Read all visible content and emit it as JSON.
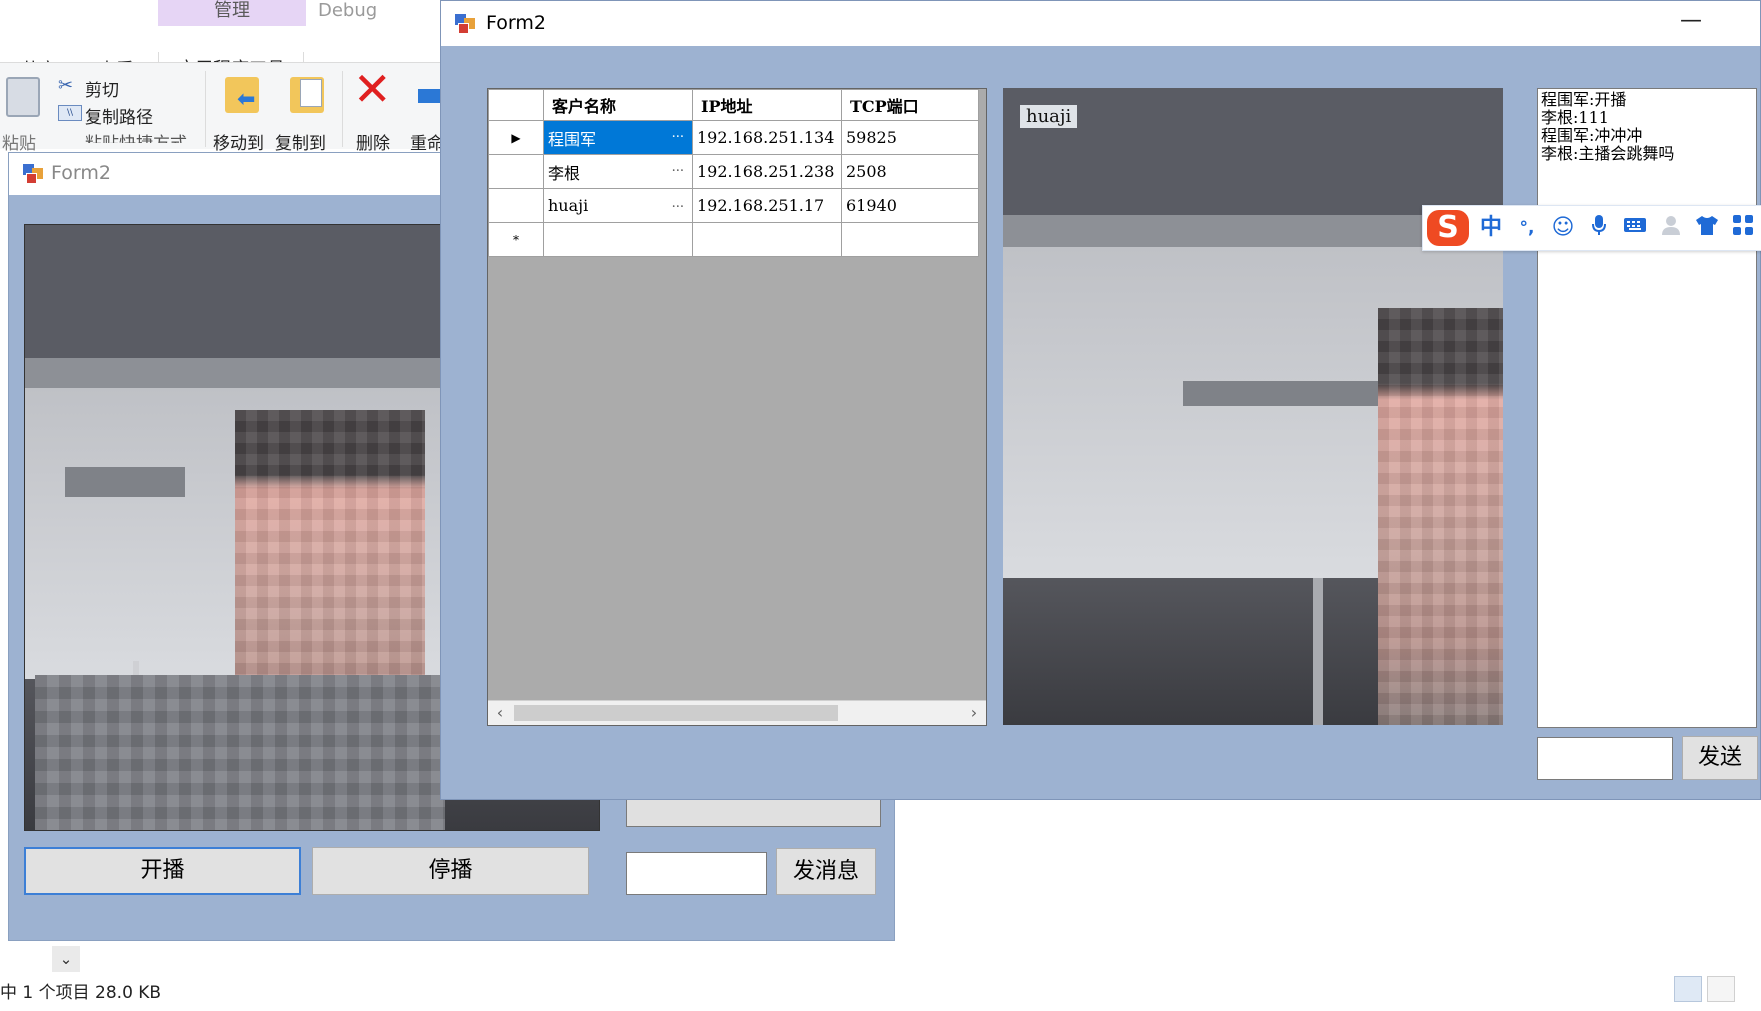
{
  "explorer": {
    "ribbon": {
      "context_header": "管理",
      "debug_label": "Debug",
      "tabs": [
        "共享",
        "查看",
        "应用程序工具"
      ],
      "buttons": {
        "paste": "粘贴",
        "cut": "剪切",
        "copy_path": "复制路径",
        "paste_shortcut": "粘贴快捷方式",
        "move_to": "移动到",
        "copy_to": "复制到",
        "delete": "删除",
        "rename": "重命"
      }
    },
    "status": {
      "selection": "中 1 个项目  28.0 KB"
    }
  },
  "form_back": {
    "title": "Form2",
    "start_button": "开播",
    "stop_button": "停播",
    "send_button": "发消息",
    "message_input": ""
  },
  "form_front": {
    "title": "Form2",
    "minimize": "—",
    "grid": {
      "columns": [
        "客户名称",
        "IP地址",
        "TCP端口"
      ],
      "rows": [
        {
          "name": "程围军",
          "ip": "192.168.251.134",
          "port": "59825",
          "selected": true
        },
        {
          "name": "李根",
          "ip": "192.168.251.238",
          "port": "2508",
          "selected": false
        },
        {
          "name": "huaji",
          "ip": "192.168.251.17",
          "port": "61940",
          "selected": false
        }
      ],
      "ellipsis": "...",
      "new_row_marker": "*",
      "current_row_marker": "▶"
    },
    "video_label": "huaji",
    "chat_lines": [
      "程围军:开播",
      "李根:111",
      "程围军:冲冲冲",
      "李根:主播会跳舞吗"
    ],
    "message_input": "",
    "send_button": "发送"
  },
  "ime": {
    "logo": "S",
    "mode": "中",
    "punct": "°,"
  }
}
